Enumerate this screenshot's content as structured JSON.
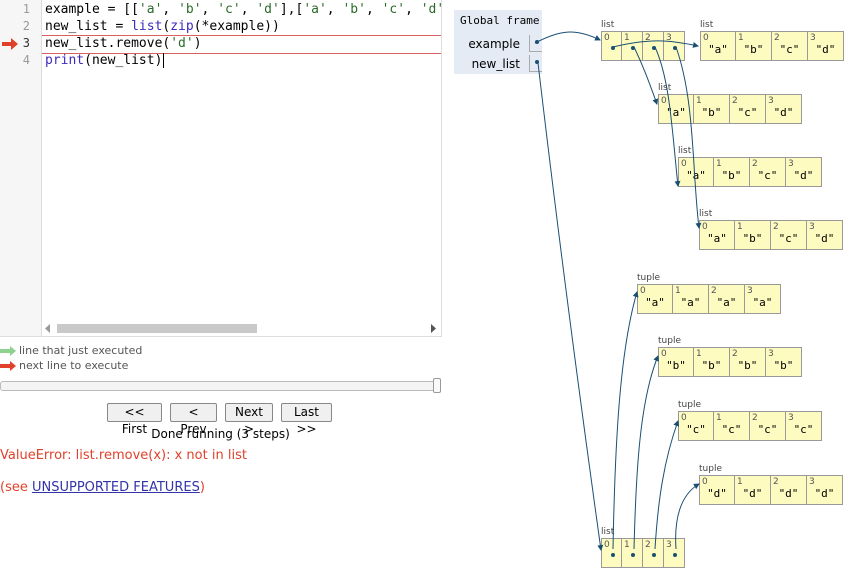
{
  "code": {
    "lines": [
      {
        "num": "1"
      },
      {
        "num": "2"
      },
      {
        "num": "3"
      },
      {
        "num": "4"
      }
    ]
  },
  "legend": {
    "executed": "line that just executed",
    "next": "next line to execute",
    "executed_color": "#8fd18f",
    "next_color": "#e0412b"
  },
  "nav": {
    "first": "<< First",
    "prev": "< Prev",
    "next": "Next >",
    "last": "Last >>",
    "status": "Done running (3 steps)"
  },
  "error": "ValueError: list.remove(x): x not in list",
  "unsupported": {
    "prefix": "(see ",
    "link": "UNSUPPORTED FEATURES",
    "suffix": ")"
  },
  "frame": {
    "title": "Global frame",
    "vars": [
      "example",
      "new_list"
    ]
  },
  "heap": {
    "list_label": "list",
    "tuple_label": "tuple",
    "example_list": {
      "indices": [
        "0",
        "1",
        "2",
        "3"
      ]
    },
    "inner_lists": [
      {
        "indices": [
          "0",
          "1",
          "2",
          "3"
        ],
        "values": [
          "\"a\"",
          "\"b\"",
          "\"c\"",
          "\"d\""
        ]
      },
      {
        "indices": [
          "0",
          "1",
          "2",
          "3"
        ],
        "values": [
          "\"a\"",
          "\"b\"",
          "\"c\"",
          "\"d\""
        ]
      },
      {
        "indices": [
          "0",
          "1",
          "2",
          "3"
        ],
        "values": [
          "\"a\"",
          "\"b\"",
          "\"c\"",
          "\"d\""
        ]
      },
      {
        "indices": [
          "0",
          "1",
          "2",
          "3"
        ],
        "values": [
          "\"a\"",
          "\"b\"",
          "\"c\"",
          "\"d\""
        ]
      }
    ],
    "tuples": [
      {
        "indices": [
          "0",
          "1",
          "2",
          "3"
        ],
        "values": [
          "\"a\"",
          "\"a\"",
          "\"a\"",
          "\"a\""
        ]
      },
      {
        "indices": [
          "0",
          "1",
          "2",
          "3"
        ],
        "values": [
          "\"b\"",
          "\"b\"",
          "\"b\"",
          "\"b\""
        ]
      },
      {
        "indices": [
          "0",
          "1",
          "2",
          "3"
        ],
        "values": [
          "\"c\"",
          "\"c\"",
          "\"c\"",
          "\"c\""
        ]
      },
      {
        "indices": [
          "0",
          "1",
          "2",
          "3"
        ],
        "values": [
          "\"d\"",
          "\"d\"",
          "\"d\"",
          "\"d\""
        ]
      }
    ],
    "new_list": {
      "indices": [
        "0",
        "1",
        "2",
        "3"
      ]
    }
  }
}
